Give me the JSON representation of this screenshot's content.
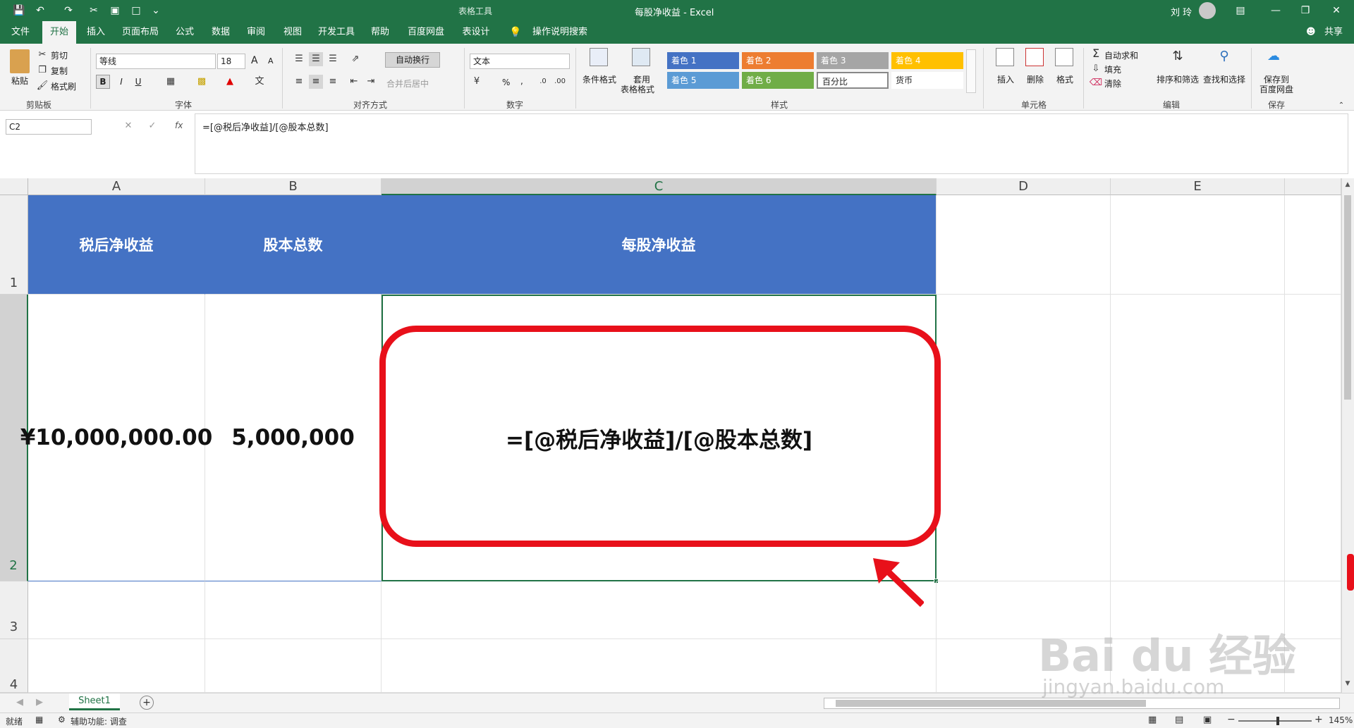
{
  "title_bar": {
    "context_tab": "表格工具",
    "window_title": "每股净收益 - Excel",
    "user_name": "刘 玲"
  },
  "ribbon_tabs": [
    "文件",
    "开始",
    "插入",
    "页面布局",
    "公式",
    "数据",
    "审阅",
    "视图",
    "开发工具",
    "帮助",
    "百度网盘",
    "表设计"
  ],
  "active_tab": "开始",
  "tell_me": "操作说明搜索",
  "share_label": "共享",
  "clipboard": {
    "paste": "粘贴",
    "cut": "剪切",
    "copy": "复制",
    "format_painter": "格式刷",
    "group": "剪贴板"
  },
  "font": {
    "name": "等线",
    "size": "18",
    "group": "字体",
    "grow_label": "A",
    "shrink_label": "A",
    "bold": "B",
    "italic": "I",
    "underline": "U"
  },
  "alignment": {
    "wrap": "自动换行",
    "merge": "合并后居中",
    "group": "对齐方式"
  },
  "number": {
    "format": "文本",
    "group": "数字",
    "percent": "%",
    "comma": ","
  },
  "styles": {
    "conditional": "条件格式",
    "table_format_line1": "套用",
    "table_format_line2": "表格格式",
    "group": "样式",
    "gallery": [
      {
        "label": "着色 1",
        "color": "#4472c4"
      },
      {
        "label": "着色 2",
        "color": "#ed7d31"
      },
      {
        "label": "着色 3",
        "color": "#a5a5a5"
      },
      {
        "label": "着色 4",
        "color": "#ffc000"
      },
      {
        "label": "着色 5",
        "color": "#5b9bd5"
      },
      {
        "label": "着色 6",
        "color": "#70ad47"
      },
      {
        "label": "百分比",
        "color": "#ffffff"
      },
      {
        "label": "货币",
        "color": "#ffffff"
      }
    ]
  },
  "cells_group": {
    "insert": "插入",
    "delete": "删除",
    "format": "格式",
    "group": "单元格"
  },
  "editing": {
    "autosum": "自动求和",
    "fill": "填充",
    "clear": "清除",
    "sort": "排序和筛选",
    "find": "查找和选择",
    "group": "编辑"
  },
  "save_group": {
    "line1": "保存到",
    "line2": "百度网盘",
    "group": "保存"
  },
  "formula_bar": {
    "name_box": "C2",
    "fx": "fx",
    "formula": "=[@税后净收益]/[@股本总数]"
  },
  "columns": [
    "A",
    "B",
    "C",
    "D",
    "E"
  ],
  "rows": [
    "1",
    "2",
    "3",
    "4"
  ],
  "header_row": [
    "税后净收益",
    "股本总数",
    "每股净收益"
  ],
  "data_row": [
    "¥10,000,000.00",
    "5,000,000",
    "=[@税后净收益]/[@股本总数]"
  ],
  "sheet_tabs": [
    "Sheet1"
  ],
  "status": {
    "ready": "就绪",
    "accessibility": "辅助功能: 调查",
    "zoom": "145%"
  },
  "watermark": {
    "brand": "Bai du 经验",
    "url": "jingyan.baidu.com"
  },
  "colors": {
    "excel_green": "#217346",
    "header_fill": "#4472c4",
    "highlight_red": "#e8101a"
  }
}
